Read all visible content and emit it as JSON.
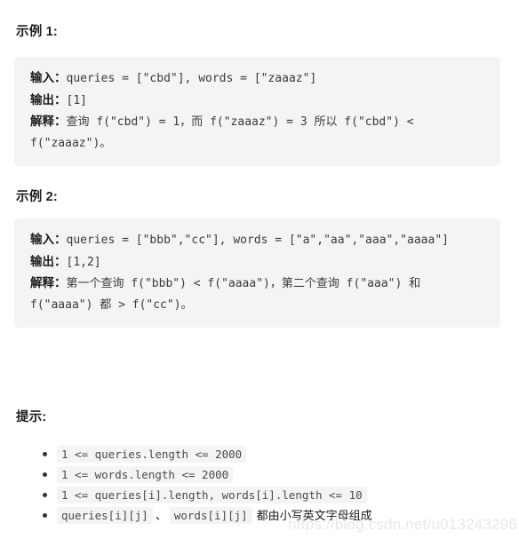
{
  "examples": [
    {
      "heading": "示例 1:",
      "lines": [
        {
          "label": "输入：",
          "text": "queries = [\"cbd\"], words = [\"zaaaz\"]"
        },
        {
          "label": "输出：",
          "text": "[1]"
        },
        {
          "label": "解释：",
          "text": "查询 f(\"cbd\") = 1，而 f(\"zaaaz\") = 3 所以 f(\"cbd\") < f(\"zaaaz\")。"
        }
      ]
    },
    {
      "heading": "示例 2:",
      "lines": [
        {
          "label": "输入：",
          "text": "queries = [\"bbb\",\"cc\"], words = [\"a\",\"aa\",\"aaa\",\"aaaa\"]"
        },
        {
          "label": "输出：",
          "text": "[1,2]"
        },
        {
          "label": "解释：",
          "text": "第一个查询 f(\"bbb\") < f(\"aaaa\")，第二个查询 f(\"aaa\") 和 f(\"aaaa\") 都 > f(\"cc\")。"
        }
      ]
    }
  ],
  "hints": {
    "heading": "提示:",
    "items": [
      {
        "code1": "1 <= queries.length <= 2000",
        "sep": "",
        "code2": "",
        "suffix": ""
      },
      {
        "code1": "1 <= words.length <= 2000",
        "sep": "",
        "code2": "",
        "suffix": ""
      },
      {
        "code1": "1 <= queries[i].length, words[i].length <= 10",
        "sep": "",
        "code2": "",
        "suffix": ""
      },
      {
        "code1": "queries[i][j]",
        "sep": "、",
        "code2": "words[i][j]",
        "suffix": "都由小写英文字母组成"
      }
    ]
  },
  "watermark": {
    "text": "https://blog.csdn.net/u013243296"
  },
  "colors": {
    "code_block_bg": "#f4f4f5",
    "page_bg": "#ffffff",
    "heading_color": "#1c1c1c",
    "watermark_color": "#e8e8e8"
  }
}
